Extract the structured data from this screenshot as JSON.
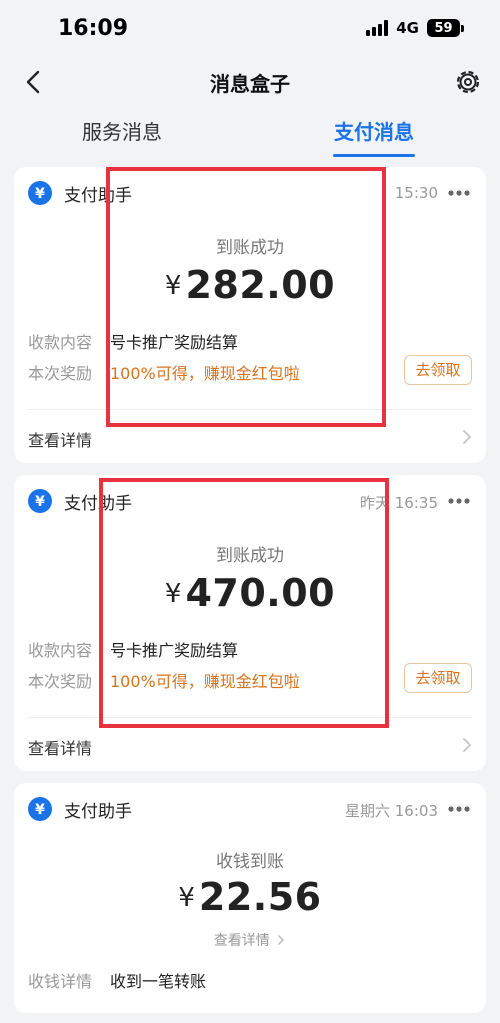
{
  "status_bar": {
    "time": "16:09",
    "network": "4G",
    "battery": "59"
  },
  "nav": {
    "title": "消息盒子"
  },
  "tabs": [
    {
      "label": "服务消息"
    },
    {
      "label": "支付消息"
    }
  ],
  "cards": [
    {
      "sender": "支付助手",
      "time": "15:30",
      "status": "到账成功",
      "currency": "¥",
      "amount": "282.00",
      "rows": [
        {
          "label": "收款内容",
          "value": "号卡推广奖励结算"
        },
        {
          "label": "本次奖励",
          "value": "100%可得，赚现金红包啦"
        }
      ],
      "button": "去领取",
      "detail": "查看详情"
    },
    {
      "sender": "支付助手",
      "time": "昨天 16:35",
      "status": "到账成功",
      "currency": "¥",
      "amount": "470.00",
      "rows": [
        {
          "label": "收款内容",
          "value": "号卡推广奖励结算"
        },
        {
          "label": "本次奖励",
          "value": "100%可得，赚现金红包啦"
        }
      ],
      "button": "去领取",
      "detail": "查看详情"
    },
    {
      "sender": "支付助手",
      "time": "星期六 16:03",
      "status": "收钱到账",
      "currency": "¥",
      "amount": "22.56",
      "detail": "查看详情",
      "rows": [
        {
          "label": "收钱详情",
          "value": "收到一笔转账"
        }
      ]
    }
  ],
  "colors": {
    "accent": "#1a73e8",
    "orange": "#d9731c",
    "highlight": "#e8323f"
  },
  "icons": {
    "back": "back-arrow-icon",
    "settings": "gear-icon",
    "sender": "yuan-icon",
    "more": "more-dots-icon"
  }
}
